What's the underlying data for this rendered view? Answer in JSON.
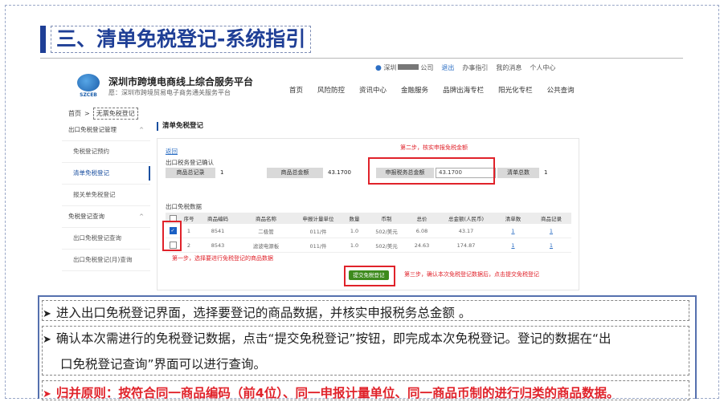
{
  "slide": {
    "title": "三、清单免税登记-系统指引"
  },
  "app": {
    "topbar": {
      "user": "深圳",
      "company_suffix": "公司",
      "logout": "退出",
      "guide": "办事指引",
      "messages": "我的消息",
      "personal": "个人中心"
    },
    "logo_text": "SZCEB",
    "brand_title": "深圳市跨境电商线上综合服务平台",
    "brand_subtitle": "愿：深圳市跨境贸易电子商务通关服务平台",
    "nav": [
      "首页",
      "风险防控",
      "资讯中心",
      "金融服务",
      "品牌出海专栏",
      "阳光化专栏",
      "公共查询"
    ],
    "breadcrumb": {
      "home": "首页",
      "separator": ">",
      "current": "无票免税登记"
    },
    "sidebar": [
      {
        "label": "出口免税登记管理",
        "group": true,
        "chev": "^"
      },
      {
        "label": "免税登记预约"
      },
      {
        "label": "清单免税登记",
        "active": true
      },
      {
        "label": "报关单免税登记"
      },
      {
        "label": "免税登记查询",
        "group": true,
        "chev": "^"
      },
      {
        "label": "出口免税登记查询"
      },
      {
        "label": "出口免税登记(月)查询"
      }
    ],
    "content": {
      "title": "清单免税登记",
      "back": "返回",
      "section1": "出口税务登记确认",
      "summary": {
        "total_records_label": "商品总记录",
        "total_records": "1",
        "total_amount_label": "商品总金额",
        "total_amount": "43.1700",
        "declared_label": "申报税务总金额",
        "declared_value": "43.1700",
        "list_count_label": "清单总数",
        "list_count": "1"
      },
      "section2": "出口免税数据",
      "table": {
        "headers": [
          "",
          "序号",
          "商品编码",
          "商品名称",
          "申报计量单位",
          "数量",
          "币制",
          "总价",
          "总金额(人民币)",
          "清单数",
          "商品记录"
        ],
        "rows": [
          {
            "checked": true,
            "cells": [
              "1",
              "8541",
              "二极管",
              "011/件",
              "1.0",
              "502/美元",
              "6.08",
              "43.17",
              "1",
              "1"
            ]
          },
          {
            "checked": false,
            "cells": [
              "2",
              "8543",
              "滤波电源板",
              "011/件",
              "1.0",
              "502/美元",
              "24.63",
              "174.87",
              "1",
              "1"
            ]
          }
        ]
      },
      "submit": "提交免税登记"
    },
    "annotations": {
      "step1": "第一步，选择要进行免税登记的商品数据",
      "step2": "第二步，核实申报免税金额",
      "step3": "第三步，确认本次免税登记数据后，点击提交免税登记"
    }
  },
  "notes": {
    "n1": "进入出口免税登记界面，选择要登记的商品数据，并核实申报税务总金额 。",
    "n2a": "确认本次需进行的免税登记数据，点击“提交免税登记”按钮，即完成本次免税登记。登记的数据在“出",
    "n2b": "口免税登记查询”界面可以进行查询。",
    "n3": "归并原则：按符合同一商品编码（前4位）、同一申报计量单位、同一商品币制的进行归类的商品数据。"
  },
  "colors": {
    "title_blue": "#1f3f96",
    "annotation_red": "#e0222a",
    "submit_green": "#3d8a1c",
    "link_blue": "#2d6fc4"
  }
}
